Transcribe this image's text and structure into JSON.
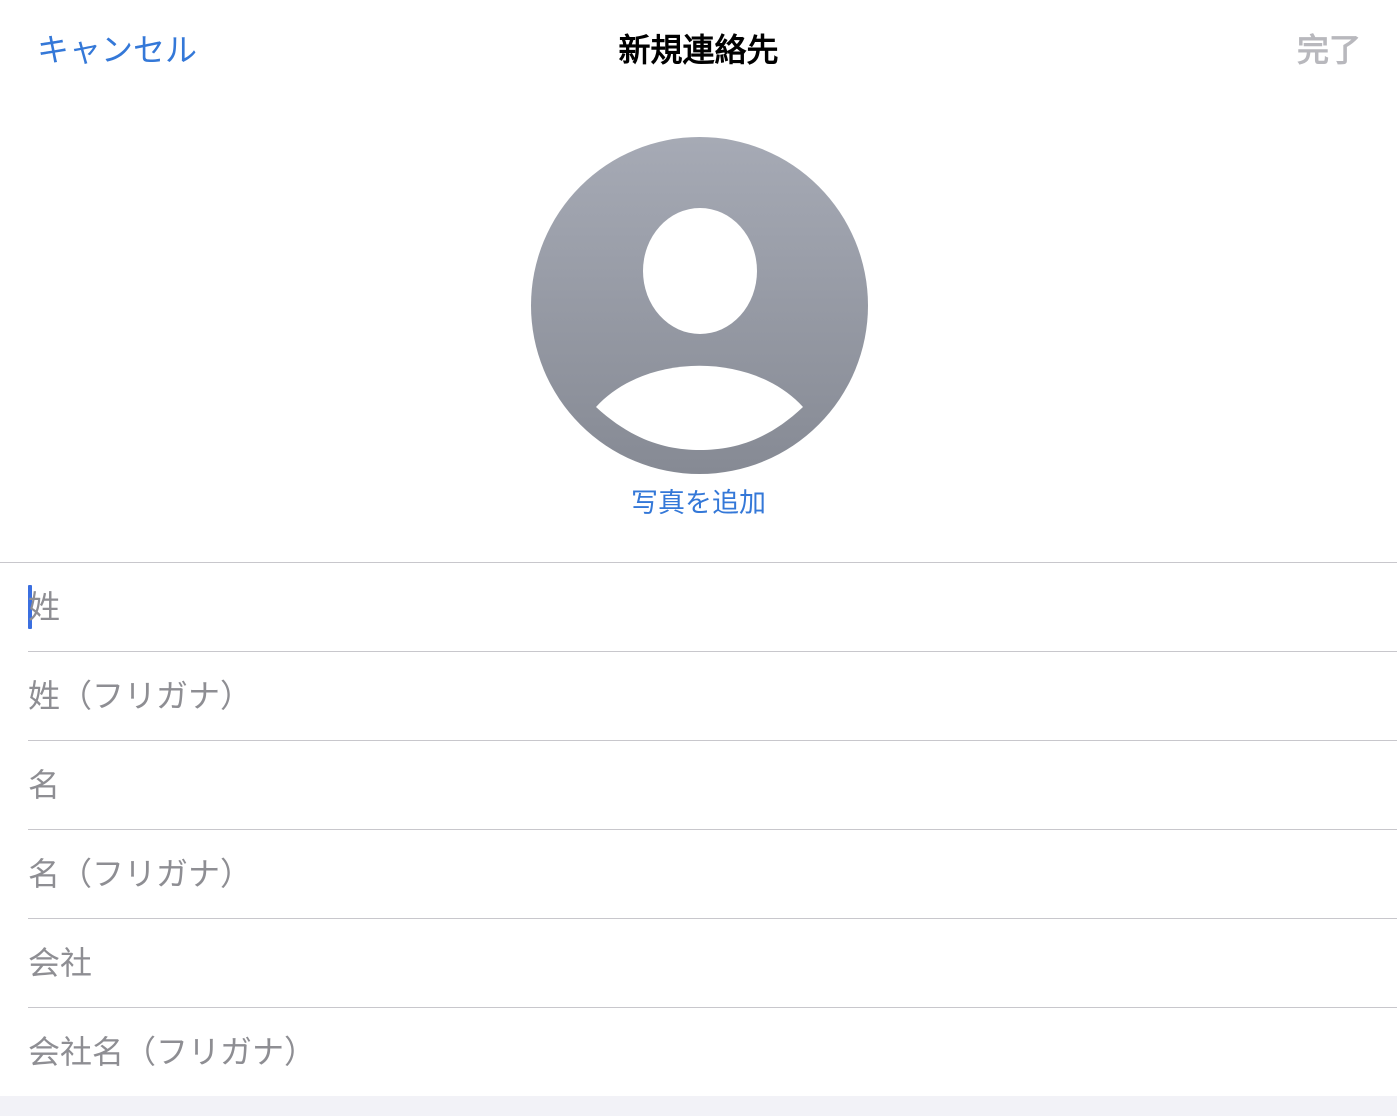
{
  "nav": {
    "cancel_label": "キャンセル",
    "title": "新規連絡先",
    "done_label": "完了"
  },
  "photo": {
    "add_label": "写真を追加",
    "icon": "person-silhouette-icon"
  },
  "fields": [
    {
      "placeholder": "姓",
      "focused": true
    },
    {
      "placeholder": "姓（フリガナ）"
    },
    {
      "placeholder": "名"
    },
    {
      "placeholder": "名（フリガナ）"
    },
    {
      "placeholder": "会社"
    },
    {
      "placeholder": "会社名（フリガナ）"
    }
  ],
  "colors": {
    "accent": "#3478d8",
    "disabled": "#b8b8bd",
    "placeholder": "#8e8e93",
    "caret": "#3b6fe0",
    "avatar_top": "#a6aab5",
    "avatar_bottom": "#868a94"
  }
}
